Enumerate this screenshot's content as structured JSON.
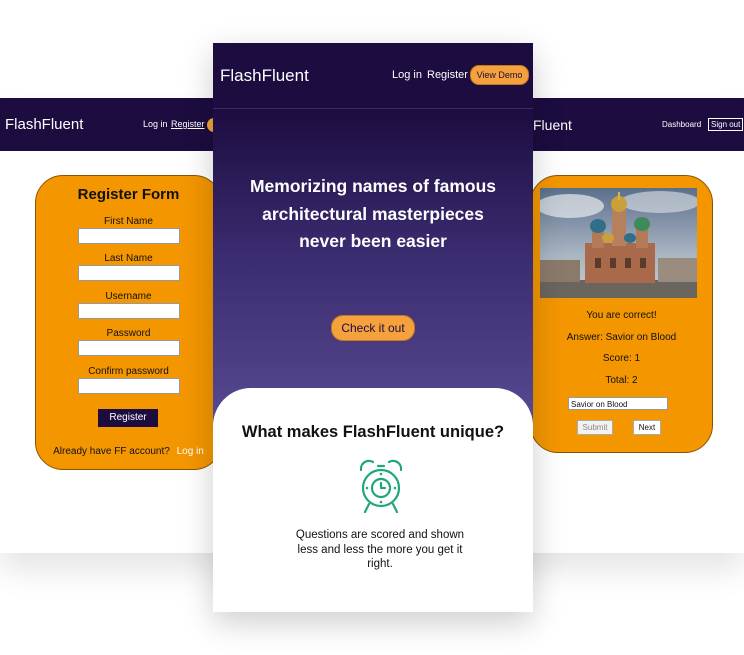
{
  "brand": "FlashFluent",
  "left_screen": {
    "nav": {
      "brand": "FlashFluent",
      "login": "Log in",
      "register": "Register"
    },
    "form": {
      "title": "Register Form",
      "fields": [
        {
          "label": "First Name",
          "value": ""
        },
        {
          "label": "Last Name",
          "value": ""
        },
        {
          "label": "Username",
          "value": ""
        },
        {
          "label": "Password",
          "value": ""
        },
        {
          "label": "Confirm password",
          "value": ""
        }
      ],
      "submit_label": "Register",
      "login_prompt": "Already have FF account?",
      "login_link": "Log in"
    }
  },
  "center_screen": {
    "nav": {
      "brand": "FlashFluent",
      "login": "Log in",
      "register": "Register",
      "demo": "View Demo"
    },
    "hero": {
      "heading": "Memorizing names of famous architectural masterpieces never been easier",
      "cta": "Check it out"
    },
    "features": {
      "title": "What makes FlashFluent unique?",
      "icon": "alarm-clock-icon",
      "text": "Questions are scored and shown less and less the more you get it right."
    }
  },
  "right_screen": {
    "nav": {
      "brand_tail": "Fluent",
      "dashboard": "Dashboard",
      "signout": "Sign out"
    },
    "quiz": {
      "feedback": "You are correct!",
      "answer": "Answer: Savior on Blood",
      "score": "Score: 1",
      "total": "Total: 2",
      "input_value": "Savior on Blood",
      "submit_label": "Submit",
      "next_label": "Next"
    }
  },
  "colors": {
    "navbar": "#1c0c40",
    "accent": "#f39600",
    "button": "#f5a13c",
    "icon": "#1fa67a"
  }
}
